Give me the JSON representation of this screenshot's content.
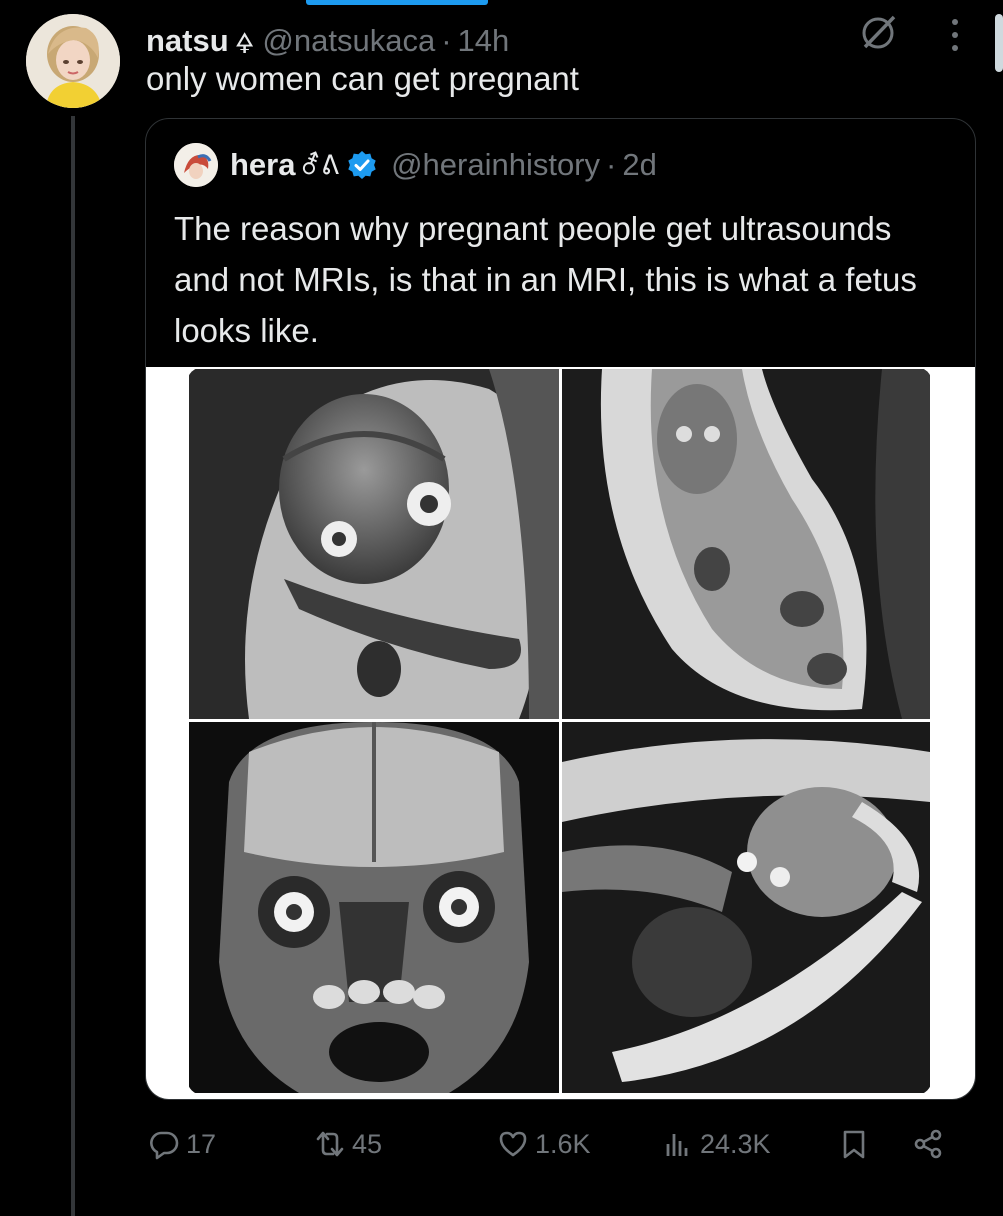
{
  "tweet": {
    "author_name": "natsu",
    "author_symbol": "🜍",
    "handle": "@natsukaca",
    "time": "14h",
    "text": "only women can get pregnant"
  },
  "quoted_tweet": {
    "author_name": "hera",
    "author_symbol": "⚦ᕕ",
    "handle": "@herainhistory",
    "time": "2d",
    "verified": true,
    "text": "The reason why pregnant people get ultrasounds and not MRIs, is that in an MRI, this is what a fetus looks like.",
    "media_description_icons": [
      "mri-image-1",
      "mri-image-2",
      "mri-image-3",
      "mri-image-4"
    ]
  },
  "actions": {
    "replies": "17",
    "reposts": "45",
    "likes": "1.6K",
    "views": "24.3K"
  },
  "colors": {
    "accent": "#1d9bf0",
    "muted": "#71767b",
    "text": "#e7e9ea",
    "border": "#2f3336"
  },
  "icons": [
    "grok-icon",
    "more-icon",
    "verified-icon",
    "reply-icon",
    "repost-icon",
    "like-icon",
    "views-icon",
    "bookmark-icon",
    "share-icon"
  ]
}
